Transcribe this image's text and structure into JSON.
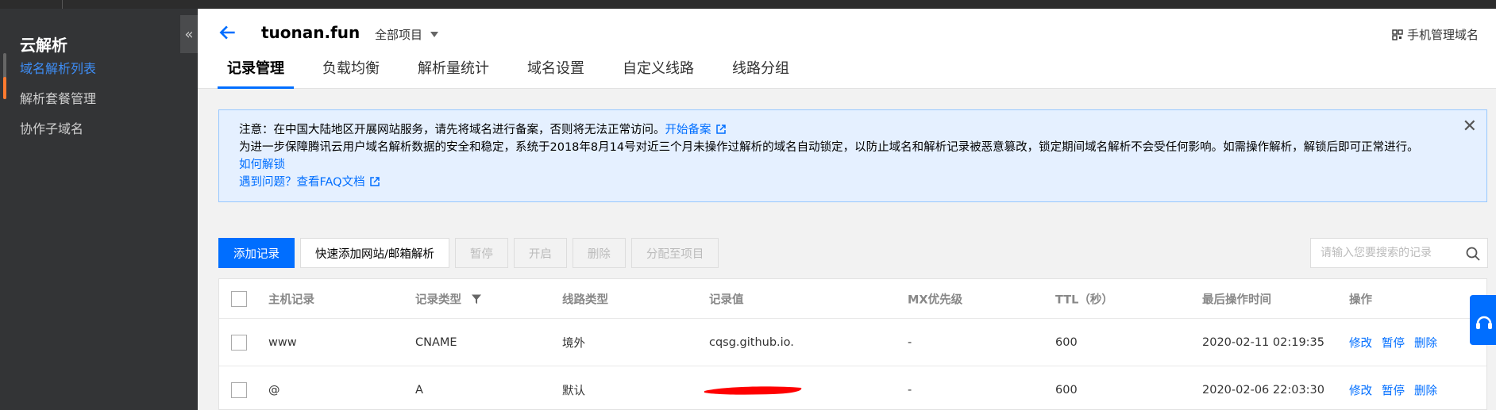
{
  "sidebar": {
    "title": "云解析",
    "items": [
      {
        "label": "域名解析列表"
      },
      {
        "label": "解析套餐管理"
      },
      {
        "label": "协作子域名"
      }
    ],
    "collapse_glyph": "«"
  },
  "header": {
    "domain": "tuonan.fun",
    "project": "全部项目",
    "mobile_link": "手机管理域名",
    "tabs": [
      {
        "label": "记录管理"
      },
      {
        "label": "负载均衡"
      },
      {
        "label": "解析量统计"
      },
      {
        "label": "域名设置"
      },
      {
        "label": "自定义线路"
      },
      {
        "label": "线路分组"
      }
    ]
  },
  "notice": {
    "line1": "注意：在中国大陆地区开展网站服务，请先将域名进行备案，否则将无法正常访问。",
    "line1_link": "开始备案",
    "line2": "为进一步保障腾讯云用户域名解析数据的安全和稳定，系统于2018年8月14号对近三个月未操作过解析的域名自动锁定，以防止域名和解析记录被恶意篡改，锁定期间域名解析不会受任何影响。如需操作解析，解锁后即可正常进行。",
    "line3_link": "如何解锁",
    "line4_prefix": "遇到问题？",
    "line4_link": "查看FAQ文档"
  },
  "toolbar": {
    "add": "添加记录",
    "quick_add": "快速添加网站/邮箱解析",
    "pause": "暂停",
    "enable": "开启",
    "delete": "删除",
    "assign": "分配至项目",
    "search_placeholder": "请输入您要搜索的记录"
  },
  "table": {
    "headers": [
      "主机记录",
      "记录类型",
      "线路类型",
      "记录值",
      "MX优先级",
      "TTL（秒）",
      "最后操作时间",
      "操作"
    ],
    "rows": [
      {
        "host": "www",
        "type": "CNAME",
        "line": "境外",
        "value": "cqsg.github.io.",
        "mx": "-",
        "ttl": "600",
        "time": "2020-02-11 02:19:35",
        "ops": [
          "修改",
          "暂停",
          "删除"
        ]
      },
      {
        "host": "@",
        "type": "A",
        "line": "默认",
        "value": "",
        "mx": "-",
        "ttl": "600",
        "time": "2020-02-06 22:03:30",
        "ops": [
          "修改",
          "暂停",
          "删除"
        ]
      }
    ]
  },
  "colors": {
    "accent": "#006eff",
    "sidebar_bg": "#333436",
    "active_marker": "#ff7a2f",
    "redaction": "#ff0000"
  }
}
